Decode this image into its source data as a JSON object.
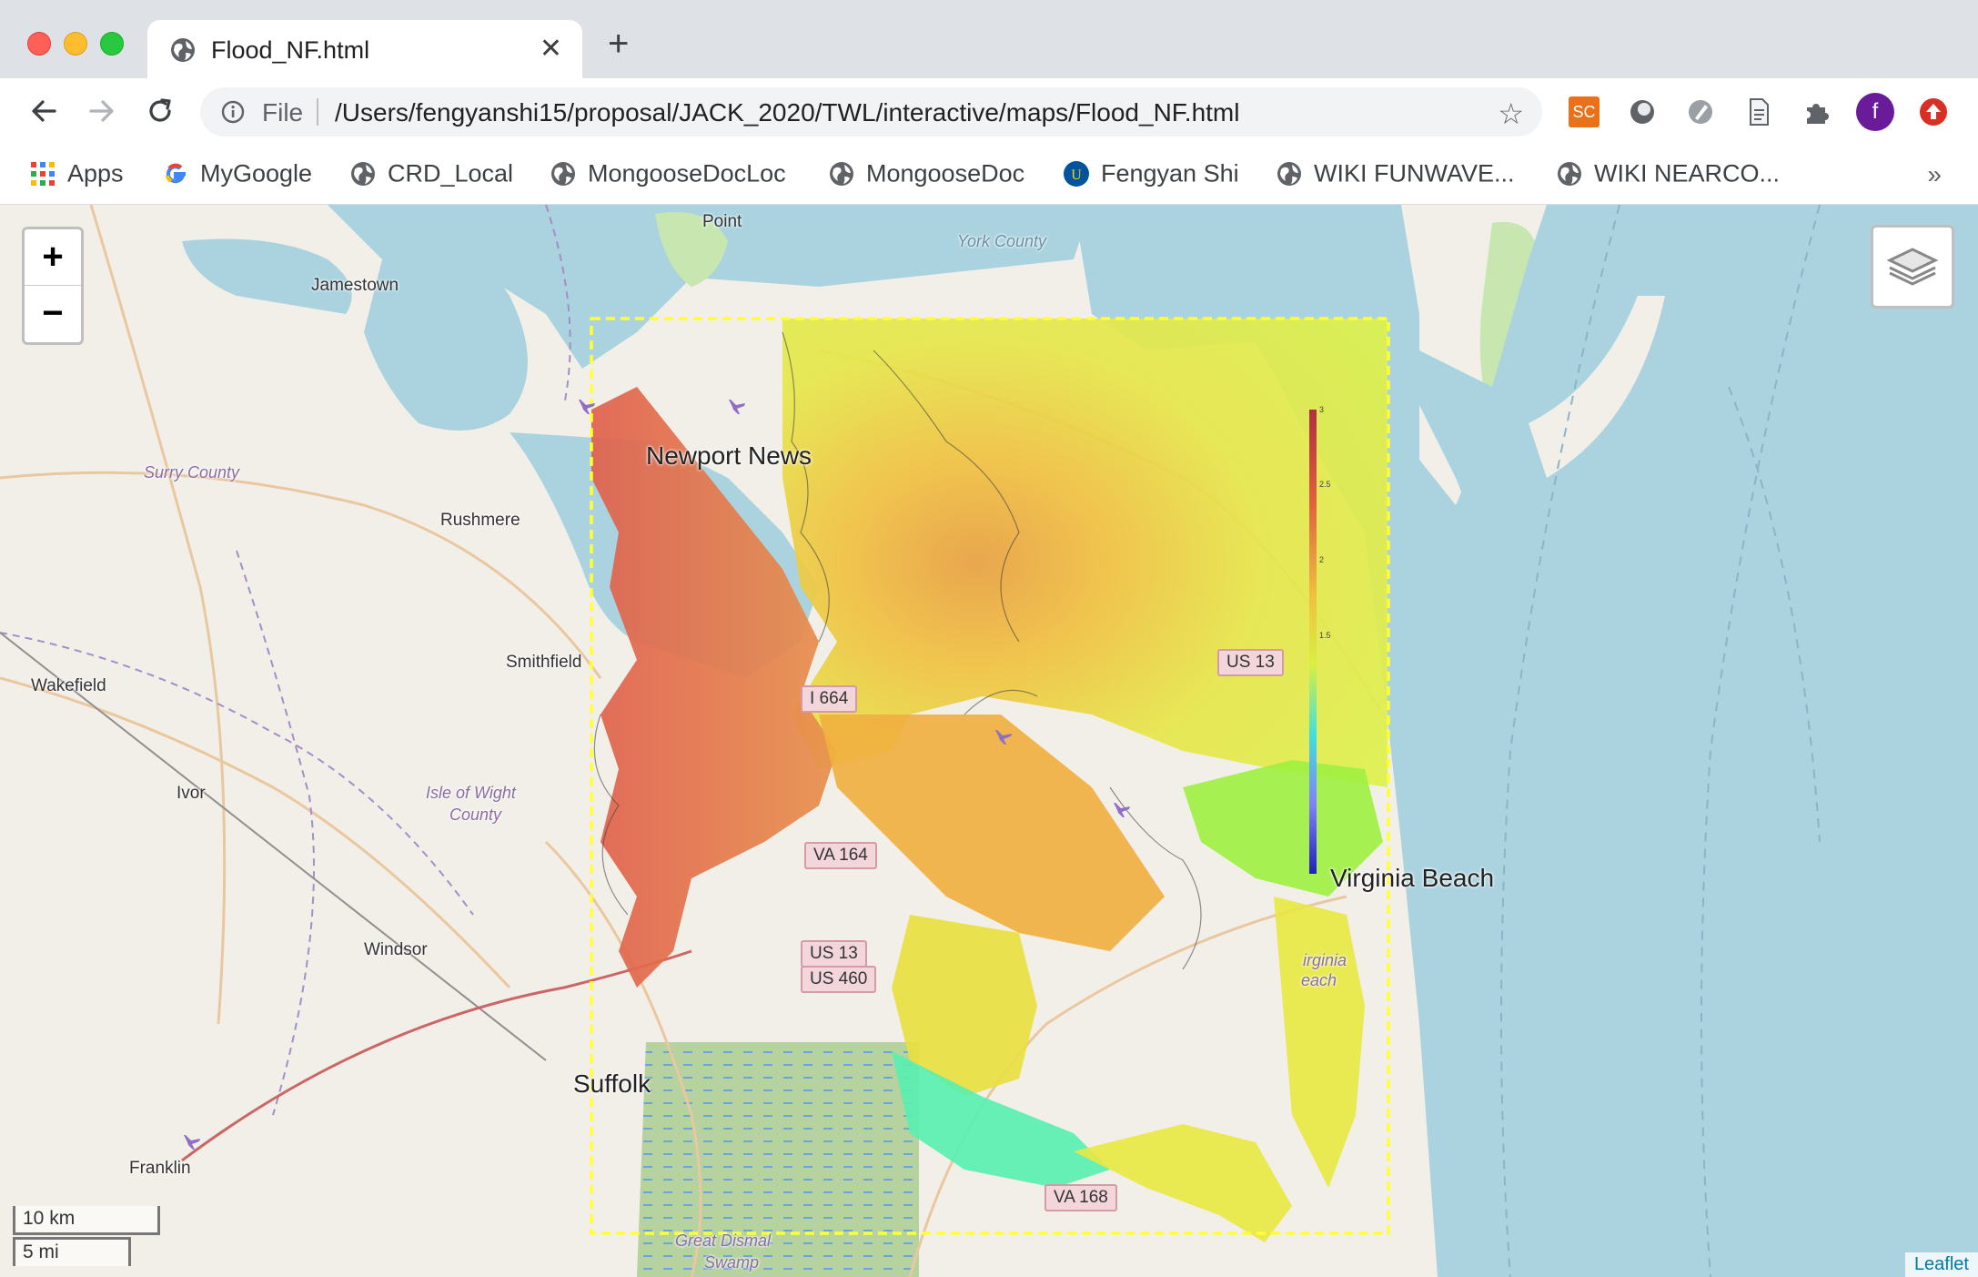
{
  "browser": {
    "tab": {
      "title": "Flood_NF.html"
    },
    "omnibox": {
      "scheme_label": "File",
      "url": "/Users/fengyanshi15/proposal/JACK_2020/TWL/interactive/maps/Flood_NF.html"
    },
    "profile_initial": "f",
    "extension_sc_label": "SC"
  },
  "bookmarks": {
    "items": [
      {
        "label": "Apps",
        "icon": "apps-grid-icon"
      },
      {
        "label": "MyGoogle",
        "icon": "google-g-icon"
      },
      {
        "label": "CRD_Local",
        "icon": "globe-icon"
      },
      {
        "label": "MongooseDocLoc",
        "icon": "globe-icon"
      },
      {
        "label": "MongooseDoc",
        "icon": "globe-icon"
      },
      {
        "label": "Fengyan Shi",
        "icon": "university-logo-icon"
      },
      {
        "label": "WIKI FUNWAVE...",
        "icon": "globe-icon"
      },
      {
        "label": "WIKI NEARCO...",
        "icon": "globe-icon"
      }
    ],
    "more": "»"
  },
  "map": {
    "zoom_in": "+",
    "zoom_out": "−",
    "scale_km": "10 km",
    "scale_mi": "5 mi",
    "attribution": "Leaflet",
    "labels": {
      "point": "Point",
      "york_county": "York County",
      "jamestown": "Jamestown",
      "newport_news": "Newport News",
      "surry_county": "Surry County",
      "rushmere": "Rushmere",
      "smithfield": "Smithfield",
      "wakefield": "Wakefield",
      "ivor": "Ivor",
      "isle_of_wight_1": "Isle of Wight",
      "isle_of_wight_2": "County",
      "windsor": "Windsor",
      "suffolk": "Suffolk",
      "franklin": "Franklin",
      "virginia_beach": "Virginia Beach",
      "great_dismal_1": "Great Dismal",
      "great_dismal_2": "Swamp",
      "virginia_beach_small_1": "irginia",
      "virginia_beach_small_2": "each"
    },
    "shields": {
      "i664": "I 664",
      "va164": "VA 164",
      "us13": "US 13",
      "us460": "US 460",
      "us13b": "US 13",
      "va168": "VA 168"
    },
    "colorbar": {
      "ticks": [
        "3",
        "2.5",
        "2",
        "1.5"
      ]
    }
  },
  "colors": {
    "accent_profile": "#6a1b9a",
    "sc_extension": "#e8711a",
    "bounds_outline": "#ffff33",
    "water": "#aad3df",
    "land": "#f2efe9"
  }
}
